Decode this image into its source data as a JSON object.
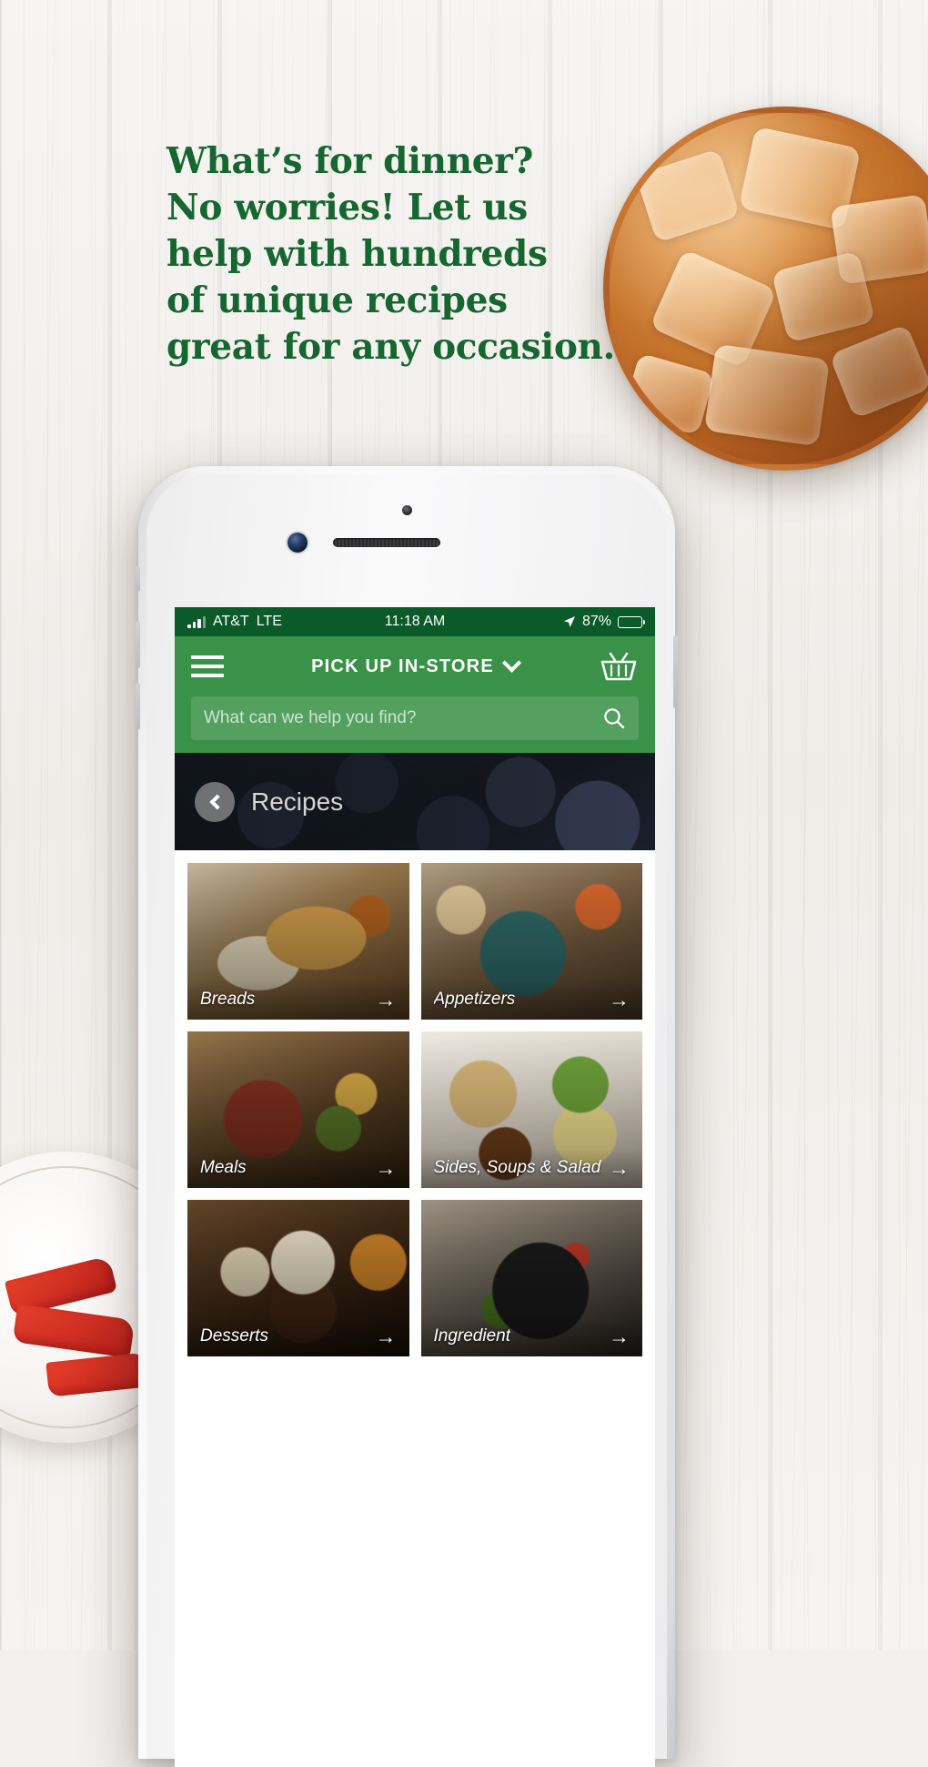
{
  "hero": {
    "headline_lines": [
      "What’s for dinner?",
      "No worries! Let us",
      "help with hundreds",
      "of unique recipes",
      "great for any occasion."
    ],
    "headline_color": "#15662f"
  },
  "phone": {
    "status_bar": {
      "carrier": "AT&T",
      "network": "LTE",
      "time": "11:18 AM",
      "battery_percent": "87%",
      "signal_icon": "signal-bars-icon",
      "location_icon": "location-arrow-icon",
      "battery_icon": "battery-icon",
      "background_color": "#0a5a2a"
    },
    "nav": {
      "menu_icon": "hamburger-icon",
      "title": "PICK UP IN-STORE",
      "chevron_icon": "chevron-down-icon",
      "basket_icon": "shopping-basket-icon",
      "background_color": "#3a9248"
    },
    "search": {
      "placeholder": "What can we help you find?",
      "value": "",
      "search_icon": "search-icon"
    },
    "banner": {
      "back_icon": "chevron-left-icon",
      "title": "Recipes"
    },
    "tiles": [
      {
        "label": "Breads",
        "arrow": "→",
        "art": "art-breads"
      },
      {
        "label": "Appetizers",
        "arrow": "→",
        "art": "art-appetizers"
      },
      {
        "label": "Meals",
        "arrow": "→",
        "art": "art-meals"
      },
      {
        "label": "Sides, Soups & Salads",
        "arrow": "→",
        "art": "art-sides"
      },
      {
        "label": "Desserts",
        "arrow": "→",
        "art": "art-desserts"
      },
      {
        "label": "Ingredient",
        "arrow": "→",
        "art": "art-ingredient"
      }
    ]
  },
  "decor": {
    "iced_tea": "iced-tea-glass",
    "plate": "plate-with-peppers"
  }
}
